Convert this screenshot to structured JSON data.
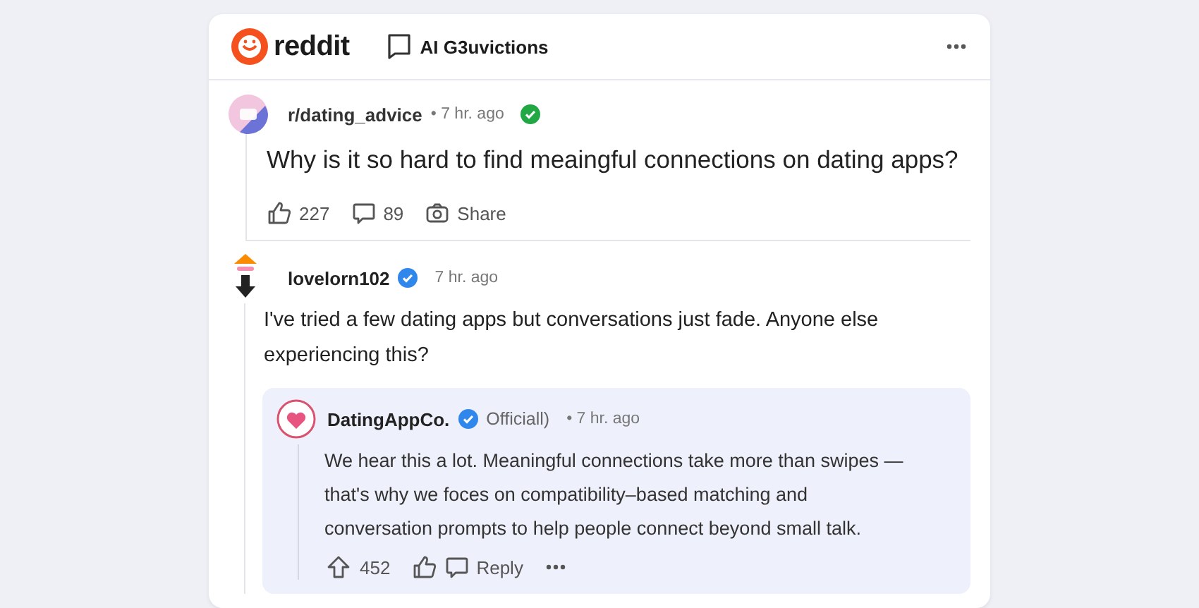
{
  "header": {
    "logo_text": "reddit",
    "title": "AI G3uvictions"
  },
  "post": {
    "subreddit": "r/dating_advice",
    "time": "• 7 hr. ago",
    "verified": true,
    "title": "Why is it so hard to find meaingful connections on dating apps?",
    "actions": [
      {
        "kind": "like",
        "label": "227"
      },
      {
        "kind": "comment",
        "label": "89"
      },
      {
        "kind": "share",
        "label": "Share"
      }
    ]
  },
  "comment": {
    "author": "lovelorn102",
    "verified": true,
    "time": "7 hr. ago",
    "body": "I've tried a few dating apps but conversations just fade. Anyone else experiencing this?",
    "reply": {
      "author": "DatingAppCo.",
      "verified": true,
      "flair": "Officiall)",
      "time": "• 7 hr. ago",
      "body": "We hear this a lot. Meaningful connections take more than swipes — that's why we foces on compatibility–based matching and conversation prompts to help people connect beyond small talk.",
      "actions": [
        {
          "kind": "upvote",
          "label": "452"
        },
        {
          "kind": "like"
        },
        {
          "kind": "comment",
          "label": "Reply"
        },
        {
          "kind": "more"
        }
      ]
    }
  }
}
